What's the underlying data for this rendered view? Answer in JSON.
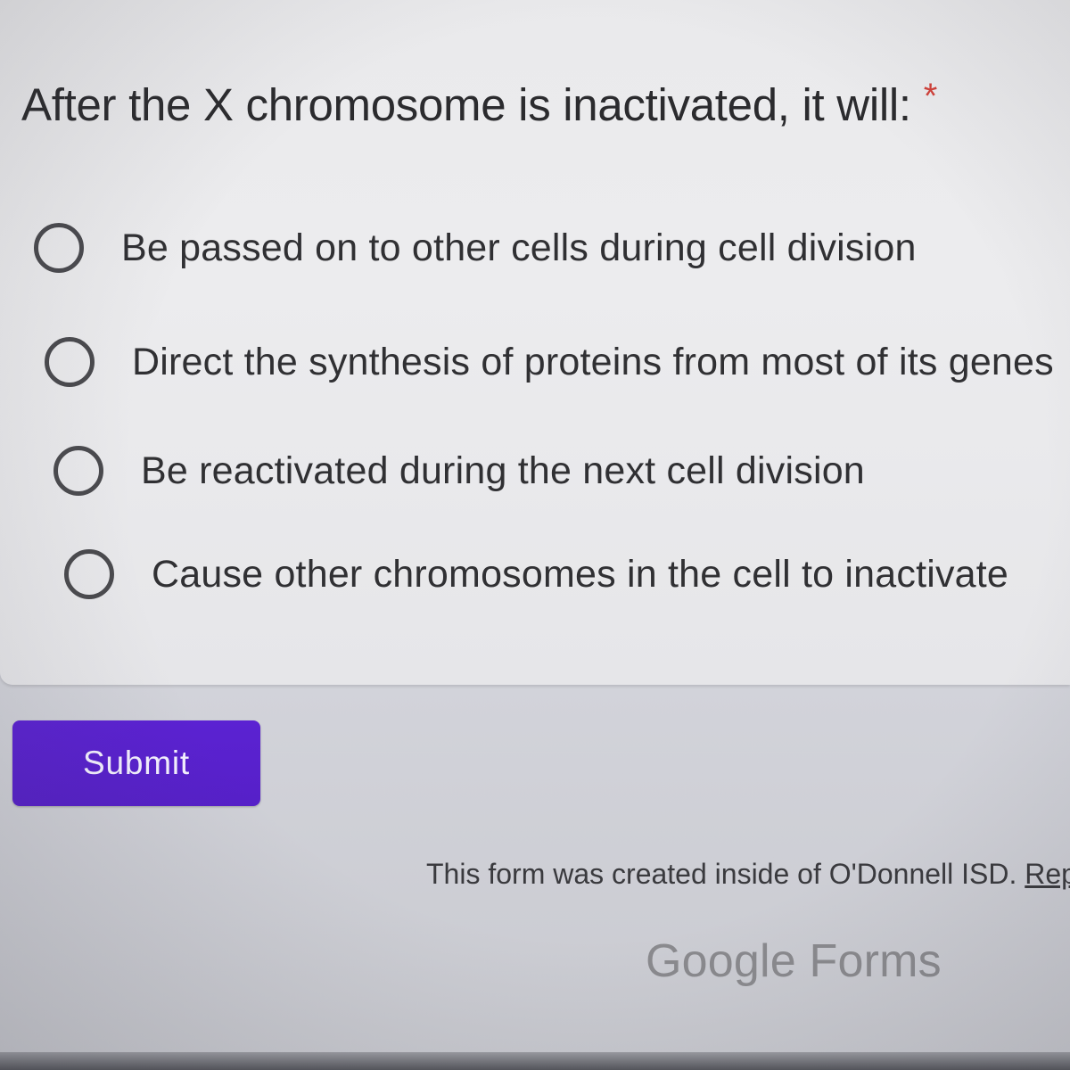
{
  "question": {
    "title": "After the X chromosome is inactivated, it will:",
    "required_marker": "*",
    "options": [
      {
        "label": "Be passed on to other cells during cell division"
      },
      {
        "label": "Direct the synthesis of proteins from most of its genes"
      },
      {
        "label": "Be reactivated during the next cell division"
      },
      {
        "label": "Cause other chromosomes in the cell to inactivate"
      }
    ]
  },
  "actions": {
    "submit_label": "Submit"
  },
  "footer": {
    "created_text": "This form was created inside of O'Donnell ISD. ",
    "link_text": "Rep"
  },
  "branding": {
    "logo_text": "Google Forms"
  },
  "colors": {
    "primary": "#5a1fcf",
    "required": "#d0413a",
    "card_background": "#ebebed"
  }
}
